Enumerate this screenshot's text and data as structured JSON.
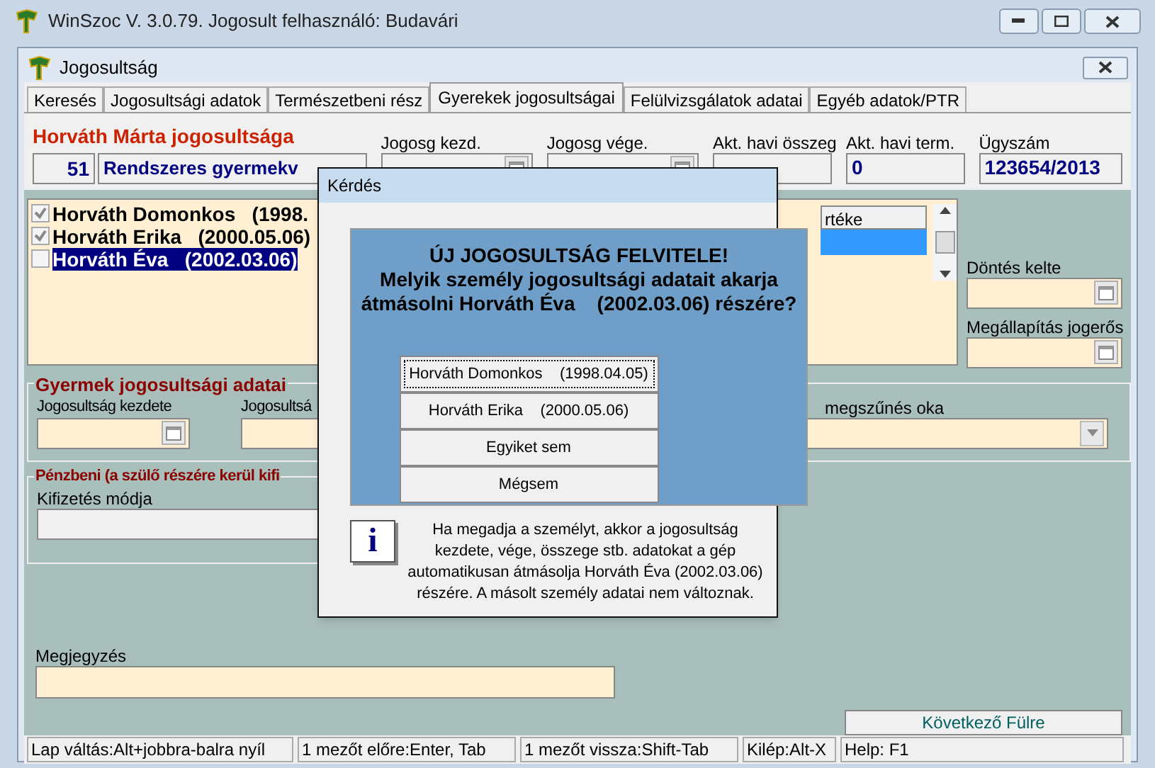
{
  "window": {
    "title": "WinSzoc V. 3.0.79. Jogosult felhasználó: Budavári"
  },
  "child_window": {
    "title": "Jogosultság"
  },
  "tabs": [
    {
      "label": "Keresés",
      "selected": false
    },
    {
      "label": "Jogosultsági adatok",
      "selected": false
    },
    {
      "label": "Természetbeni rész",
      "selected": false
    },
    {
      "label": "Gyerekek jogosultságai",
      "selected": true
    },
    {
      "label": "Felülvizsgálatok adatai",
      "selected": false
    },
    {
      "label": "Egyéb adatok/PTR",
      "selected": false
    }
  ],
  "header": {
    "title": "Horváth Márta jogosultsága",
    "code": "51",
    "type": "Rendszeres gyermekv",
    "fields": [
      {
        "label": "Jogosg kezd.",
        "kind": "date"
      },
      {
        "label": "Jogosg vége.",
        "kind": "date"
      },
      {
        "label": "Akt. havi összeg",
        "kind": "text"
      },
      {
        "label": "Akt. havi term.",
        "kind": "text",
        "value": "0"
      },
      {
        "label": "Ügyszám",
        "kind": "text",
        "value": "123654/2013"
      }
    ]
  },
  "persons": [
    {
      "name": "Horváth Domonkos",
      "date": "(1998.",
      "checked": true,
      "selected": false
    },
    {
      "name": "Horváth Erika",
      "date": "(2000.05.06)",
      "checked": true,
      "selected": false
    },
    {
      "name": "Horváth Éva",
      "date": "(2002.03.06)",
      "checked": false,
      "selected": true
    }
  ],
  "grid": {
    "column": "rtéke"
  },
  "side_fields": [
    {
      "label": "Döntés kelte"
    },
    {
      "label": "Megállapítás jogerős"
    }
  ],
  "child_group": {
    "title": "Gyermek jogosultsági adatai",
    "fields": [
      {
        "label": "Jogosultság kezdete"
      },
      {
        "label": "Jogosultsá"
      }
    ],
    "end_reason_label": "megszűnés oka"
  },
  "payment_group": {
    "title": "Pénzbeni (a szülő részére kerül kifi",
    "method_label": "Kifizetés módja"
  },
  "note": {
    "label": "Megjegyzés"
  },
  "next_button": "Következő Fülre",
  "status_bar": [
    "Lap váltás:Alt+jobbra-balra nyíl",
    "1 mezőt előre:Enter, Tab",
    "1 mezőt vissza:Shift-Tab",
    "Kilép:Alt-X",
    "Help: F1"
  ],
  "dialog": {
    "title": "Kérdés",
    "heading": "ÚJ JOGOSULTSÁG FELVITELE!",
    "question_lines": [
      "Melyik személy jogosultsági adatait akarja",
      "átmásolni Horváth Éva    (2002.03.06) részére?"
    ],
    "buttons": [
      {
        "label": "Horváth Domonkos    (1998.04.05)",
        "selected": true
      },
      {
        "label": "Horváth Erika    (2000.05.06)",
        "selected": false
      },
      {
        "label": "Egyiket sem",
        "selected": false
      },
      {
        "label": "Mégsem",
        "selected": false
      }
    ],
    "info_icon": "i",
    "info": "Ha megadja a személyt, akkor a jogosultság kezdete, vége, összege stb. adatokat a gép automatikusan átmásolja Horváth Éva (2002.03.06) részére. A másolt személy adatai nem változnak."
  }
}
